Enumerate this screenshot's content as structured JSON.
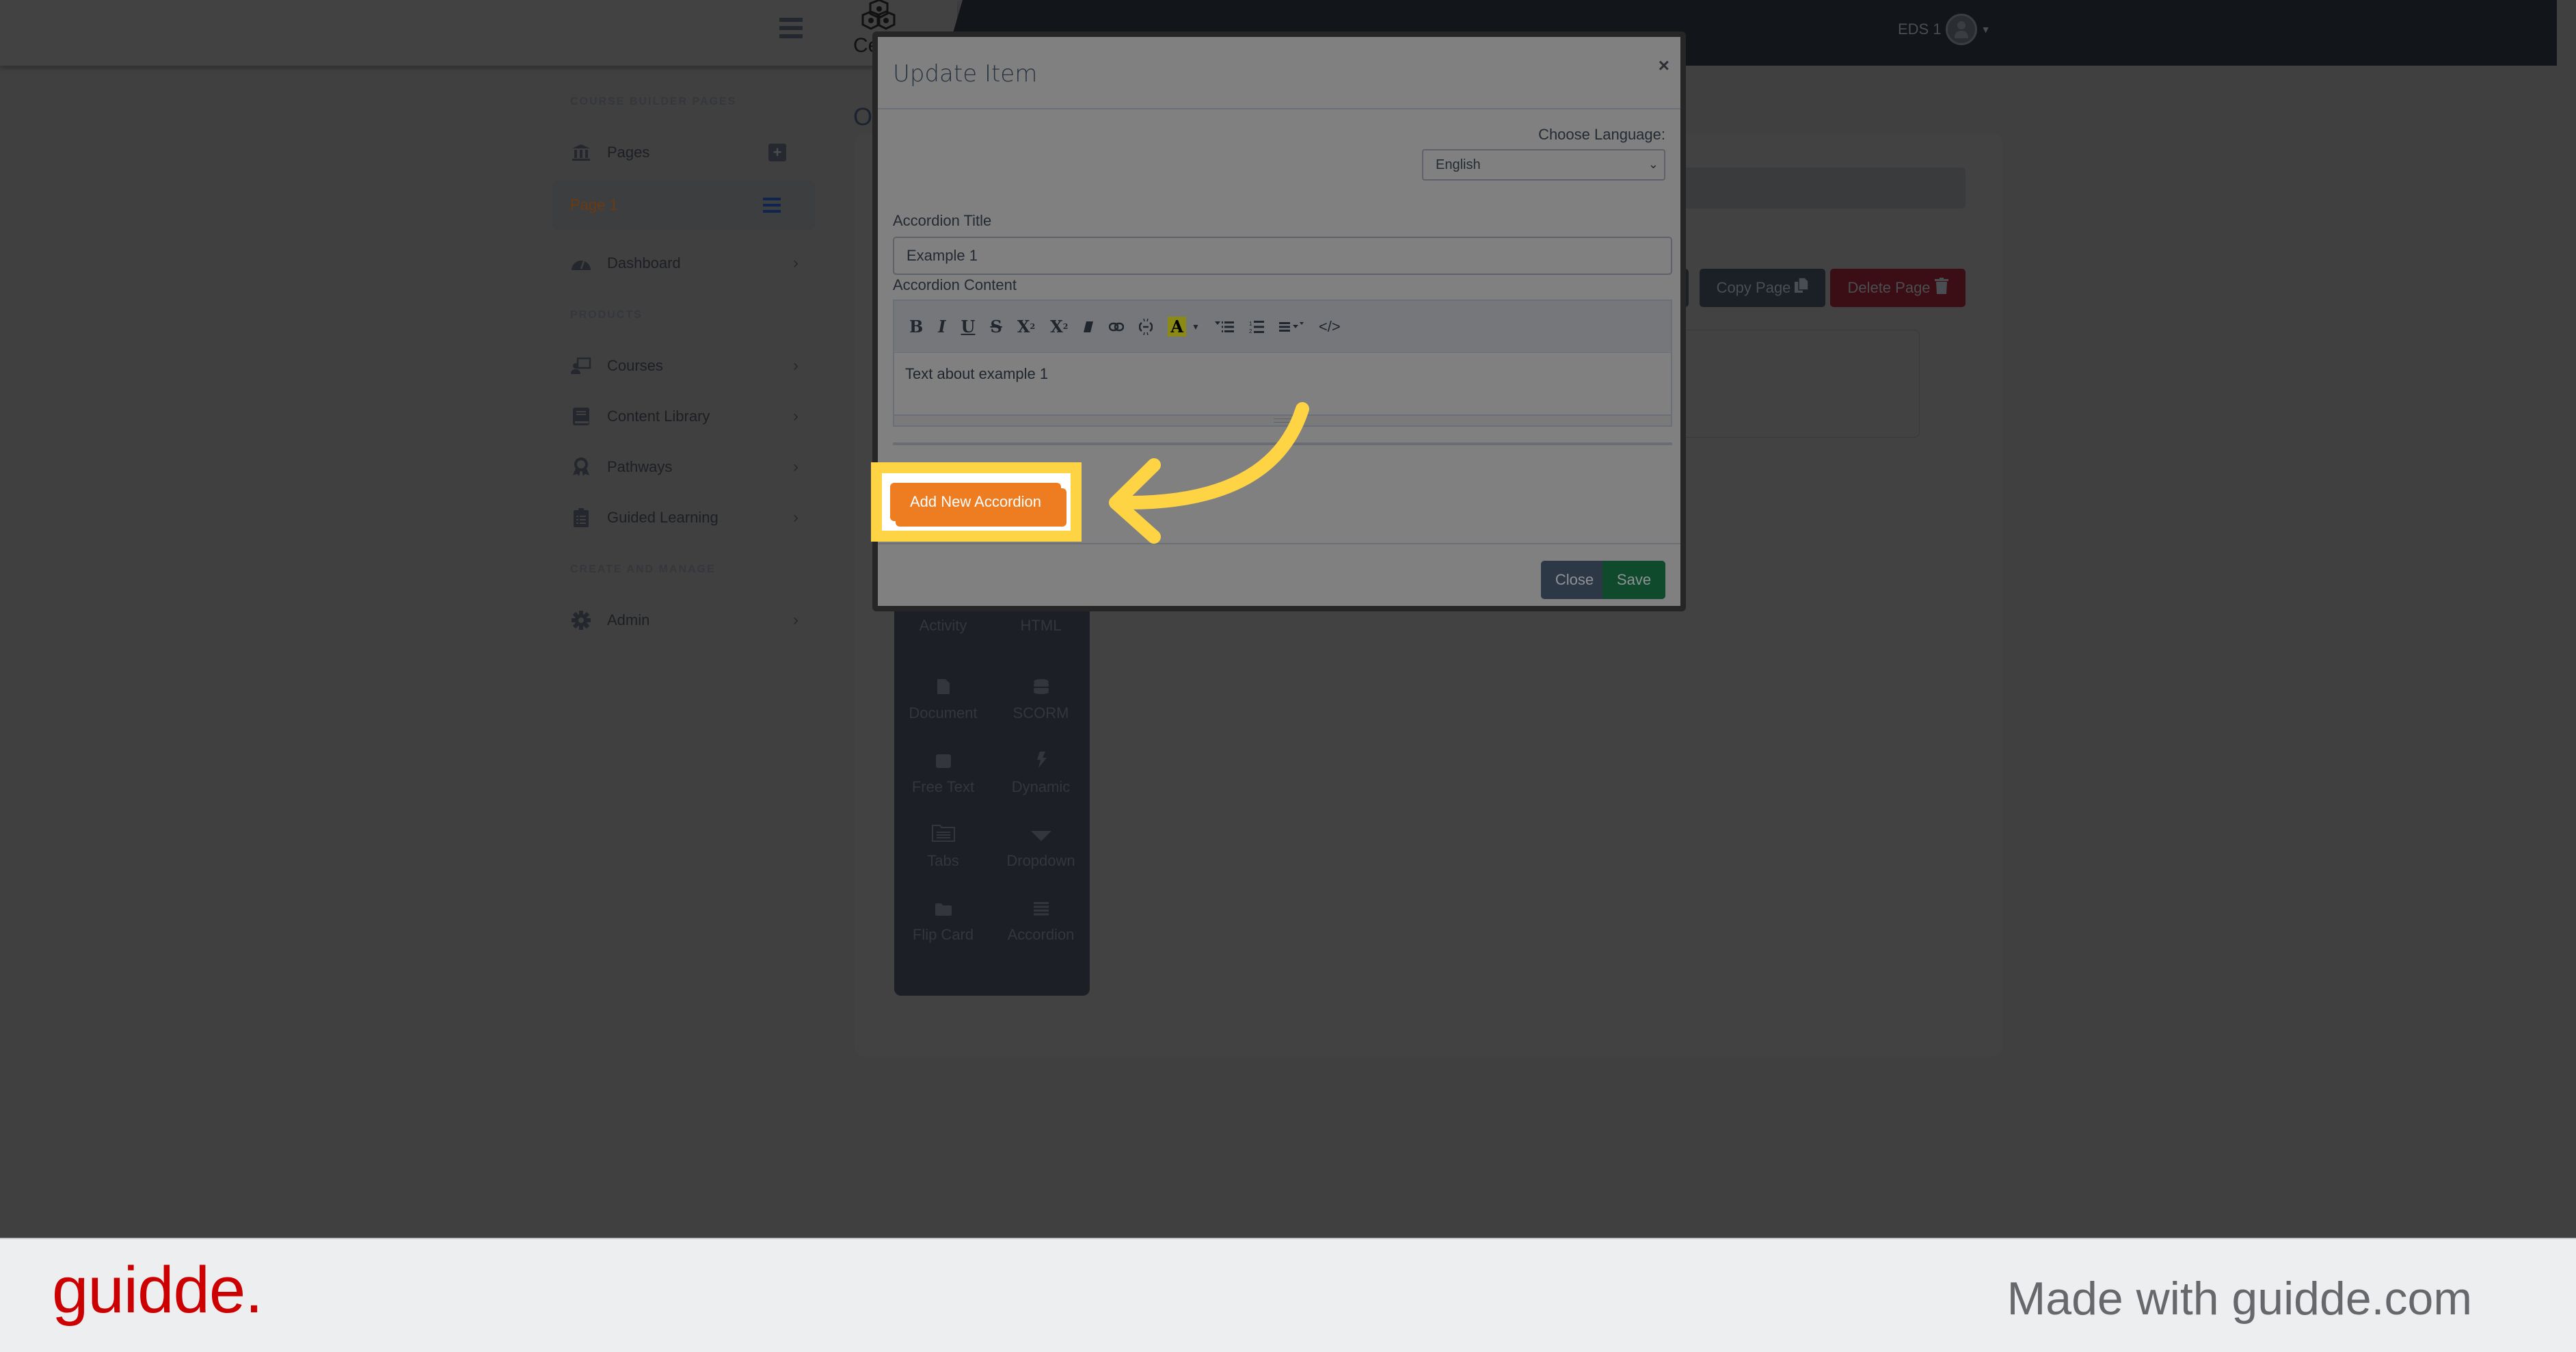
{
  "header": {
    "logo_text": "Ce",
    "user_name": "EDS 1"
  },
  "sidebar": {
    "section_course_builder": "COURSE BUILDER PAGES",
    "pages_label": "Pages",
    "active_page_label": "Page 1",
    "dashboard_label": "Dashboard",
    "section_products": "PRODUCTS",
    "products": [
      {
        "label": "Courses",
        "icon": "chalkboard-teacher-icon"
      },
      {
        "label": "Content Library",
        "icon": "book-icon"
      },
      {
        "label": "Pathways",
        "icon": "award-icon"
      },
      {
        "label": "Guided Learning",
        "icon": "clipboard-list-icon"
      }
    ],
    "section_create": "CREATE AND MANAGE",
    "admin_label": "Admin"
  },
  "main": {
    "heading_partial": "O",
    "copy_page_label": "Copy Page",
    "delete_page_label": "Delete Page",
    "palette": [
      {
        "label": "Activity",
        "icon": "activity-icon"
      },
      {
        "label": "HTML",
        "icon": "code-icon"
      },
      {
        "label": "Document",
        "icon": "file-icon"
      },
      {
        "label": "SCORM",
        "icon": "database-icon"
      },
      {
        "label": "Free Text",
        "icon": "square-icon"
      },
      {
        "label": "Dynamic",
        "icon": "bolt-icon"
      },
      {
        "label": "Tabs",
        "icon": "tabs-icon"
      },
      {
        "label": "Dropdown",
        "icon": "caret-down-icon"
      },
      {
        "label": "Flip Card",
        "icon": "folder-icon"
      },
      {
        "label": "Accordion",
        "icon": "bars-icon"
      }
    ]
  },
  "modal": {
    "title": "Update Item",
    "close_symbol": "×",
    "language_label": "Choose Language:",
    "language_selected": "English",
    "accordion_title_label": "Accordion Title",
    "accordion_title_value": "Example 1",
    "accordion_content_label": "Accordion Content",
    "accordion_content_value": "Text about example 1",
    "toolbar": [
      "bold",
      "italic",
      "underline",
      "strikethrough",
      "superscript",
      "subscript",
      "clear-format",
      "link",
      "unlink",
      "text-color",
      "unordered-list",
      "ordered-list",
      "align",
      "code-view"
    ],
    "add_button_label": "Add New Accordion",
    "close_button_label": "Close",
    "save_button_label": "Save"
  },
  "annotation": {
    "highlight_color": "#ffd444"
  },
  "branding": {
    "logo": "guidde.",
    "made_with": "Made with guidde.com",
    "logo_color": "#cc0000"
  }
}
